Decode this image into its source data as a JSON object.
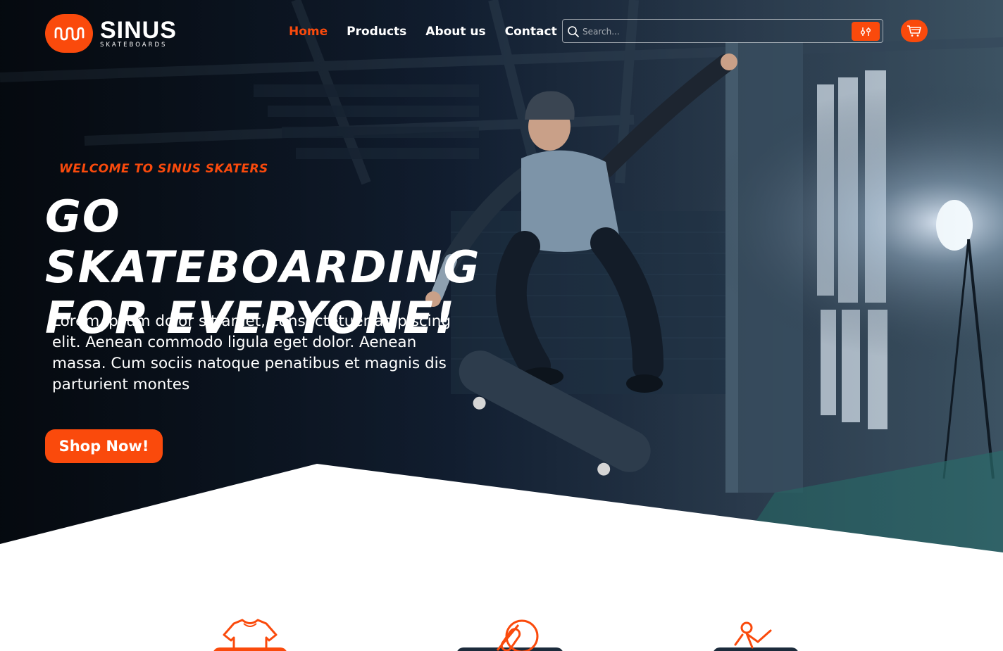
{
  "brand": {
    "name": "SINUS",
    "tagline": "SKATEBOARDS",
    "accent_color": "#fa4a0c",
    "logo_icon": "wave-logo-icon"
  },
  "nav": {
    "items": [
      {
        "label": "Home",
        "active": true
      },
      {
        "label": "Products",
        "active": false
      },
      {
        "label": "About us",
        "active": false
      },
      {
        "label": "Contact",
        "active": false
      }
    ]
  },
  "search": {
    "placeholder": "Search...",
    "value": "",
    "icon": "search-icon",
    "filter_icon": "sliders-icon"
  },
  "cart": {
    "icon": "cart-icon"
  },
  "hero": {
    "welcome": "Welcome to  Sinus Skaters",
    "headline_line1": "GO SKATEBOARDING",
    "headline_line2": "FOR EVERYONE!",
    "lead": "Lorem ipsum dolor sit amet, consectetuer adipiscing elit. Aenean commodo ligula eget dolor. Aenean massa. Cum sociis natoque penatibus et magnis dis parturient montes",
    "cta_label": "Shop Now!",
    "background": "skater-photo"
  },
  "features": [
    {
      "icon": "tshirt-icon"
    },
    {
      "icon": "skateboard-icon"
    },
    {
      "icon": "skater-icon"
    }
  ]
}
